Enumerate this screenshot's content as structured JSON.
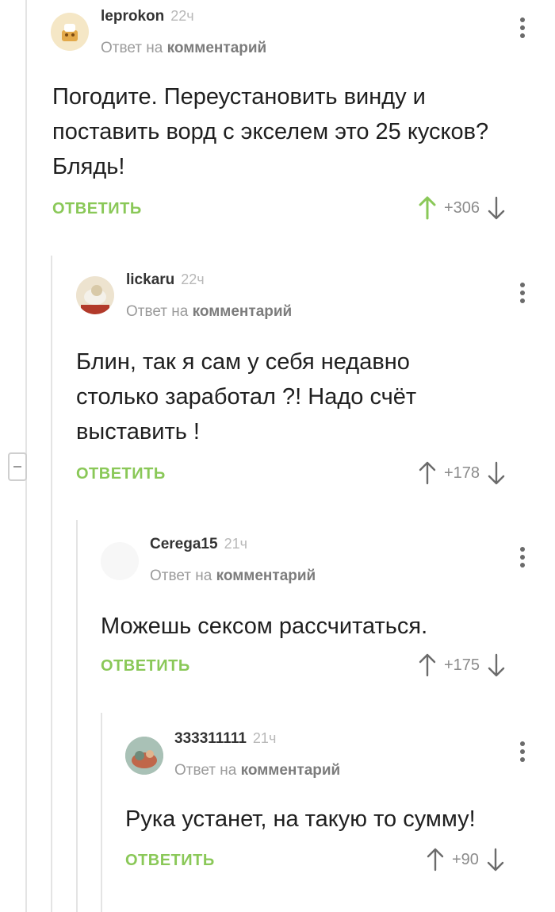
{
  "comments": [
    {
      "author": "leprokon",
      "time": "22ч",
      "reply_prefix": "Ответ на",
      "reply_link": "комментарий",
      "lines": [
        "Погодите. Переустановить винду и",
        "поставить ворд с экселем это 25 кусков?",
        "Блядь!"
      ],
      "reply_label": "ОТВЕТИТЬ",
      "score": "+306",
      "upvoted": true
    },
    {
      "author": "lickaru",
      "time": "22ч",
      "reply_prefix": "Ответ на",
      "reply_link": "комментарий",
      "lines": [
        "Блин, так я сам у себя недавно",
        "столько заработал ?! Надо счёт",
        "выставить !"
      ],
      "reply_label": "ОТВЕТИТЬ",
      "score": "+178",
      "upvoted": false
    },
    {
      "author": "Cerega15",
      "time": "21ч",
      "reply_prefix": "Ответ на",
      "reply_link": "комментарий",
      "lines": [
        "Можешь сексом рассчитаться."
      ],
      "reply_label": "ОТВЕТИТЬ",
      "score": "+175",
      "upvoted": false
    },
    {
      "author": "333311111",
      "time": "21ч",
      "reply_prefix": "Ответ на",
      "reply_link": "комментарий",
      "lines": [
        "Рука устанет, на такую то сумму!"
      ],
      "reply_label": "ОТВЕТИТЬ",
      "score": "+90",
      "upvoted": false
    }
  ],
  "colors": {
    "accent": "#8ac858",
    "upvote_active": "#8ac858",
    "arrow_default": "#6b6b6b"
  },
  "icons": [
    "kebab-menu-icon",
    "upvote-arrow-icon",
    "downvote-arrow-icon",
    "collapse-thread-icon"
  ]
}
